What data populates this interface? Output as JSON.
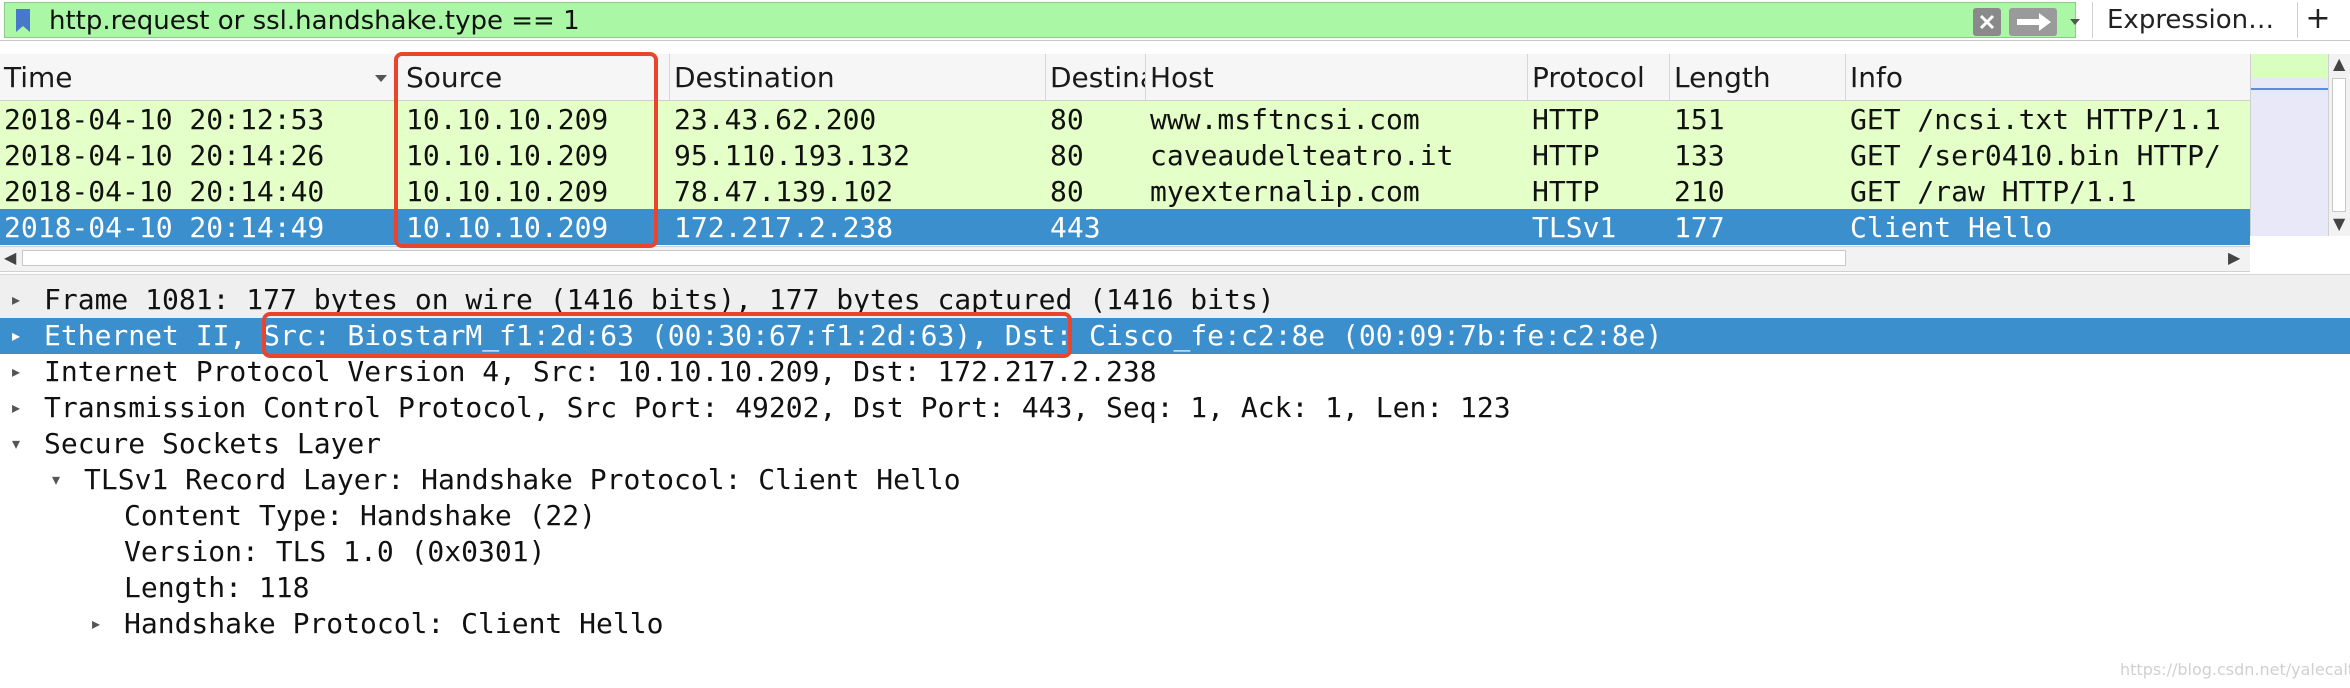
{
  "filter": {
    "text": "http.request or ssl.handshake.type == 1",
    "expression_label": "Expression…",
    "plus_label": "+"
  },
  "colors": {
    "filter_valid_bg": "#aaf7a6",
    "http_row_bg": "#e4ffc7",
    "selected_row_bg": "#3c8fcd",
    "highlight_border": "#e8452c"
  },
  "packet_list": {
    "columns": [
      "Time",
      "Source",
      "Destination",
      "Destina",
      "Host",
      "Protocol",
      "Length",
      "Info"
    ],
    "rows": [
      {
        "time": "2018-04-10 20:12:53",
        "source": "10.10.10.209",
        "destination": "23.43.62.200",
        "dport": "80",
        "host": "www.msftncsi.com",
        "protocol": "HTTP",
        "length": "151",
        "info": "GET /ncsi.txt HTTP/1.1",
        "selected": false
      },
      {
        "time": "2018-04-10 20:14:26",
        "source": "10.10.10.209",
        "destination": "95.110.193.132",
        "dport": "80",
        "host": "caveaudelteatro.it",
        "protocol": "HTTP",
        "length": "133",
        "info": "GET /ser0410.bin HTTP/",
        "selected": false
      },
      {
        "time": "2018-04-10 20:14:40",
        "source": "10.10.10.209",
        "destination": "78.47.139.102",
        "dport": "80",
        "host": "myexternalip.com",
        "protocol": "HTTP",
        "length": "210",
        "info": "GET /raw HTTP/1.1",
        "selected": false
      },
      {
        "time": "2018-04-10 20:14:49",
        "source": "10.10.10.209",
        "destination": "172.217.2.238",
        "dport": "443",
        "host": "",
        "protocol": "TLSv1",
        "length": "177",
        "info": "Client Hello",
        "selected": true
      }
    ]
  },
  "details": [
    {
      "text": "Frame 1081: 177 bytes on wire (1416 bits), 177 bytes captured (1416 bits)",
      "depth": 0,
      "toggle": "collapsed",
      "selected": false
    },
    {
      "text": "Ethernet II, Src: BiostarM_f1:2d:63 (00:30:67:f1:2d:63), Dst: Cisco_fe:c2:8e (00:09:7b:fe:c2:8e)",
      "depth": 0,
      "toggle": "collapsed",
      "selected": true
    },
    {
      "text": "Internet Protocol Version 4, Src: 10.10.10.209, Dst: 172.217.2.238",
      "depth": 0,
      "toggle": "collapsed",
      "selected": false
    },
    {
      "text": "Transmission Control Protocol, Src Port: 49202, Dst Port: 443, Seq: 1, Ack: 1, Len: 123",
      "depth": 0,
      "toggle": "collapsed",
      "selected": false
    },
    {
      "text": "Secure Sockets Layer",
      "depth": 0,
      "toggle": "expanded",
      "selected": false
    },
    {
      "text": "TLSv1 Record Layer: Handshake Protocol: Client Hello",
      "depth": 1,
      "toggle": "expanded",
      "selected": false
    },
    {
      "text": "Content Type: Handshake (22)",
      "depth": 2,
      "toggle": "none",
      "selected": false
    },
    {
      "text": "Version: TLS 1.0 (0x0301)",
      "depth": 2,
      "toggle": "none",
      "selected": false
    },
    {
      "text": "Length: 118",
      "depth": 2,
      "toggle": "none",
      "selected": false
    },
    {
      "text": "Handshake Protocol: Client Hello",
      "depth": 2,
      "toggle": "collapsed",
      "selected": false
    }
  ],
  "watermark": "https://blog.csdn.net/yalecaltech"
}
